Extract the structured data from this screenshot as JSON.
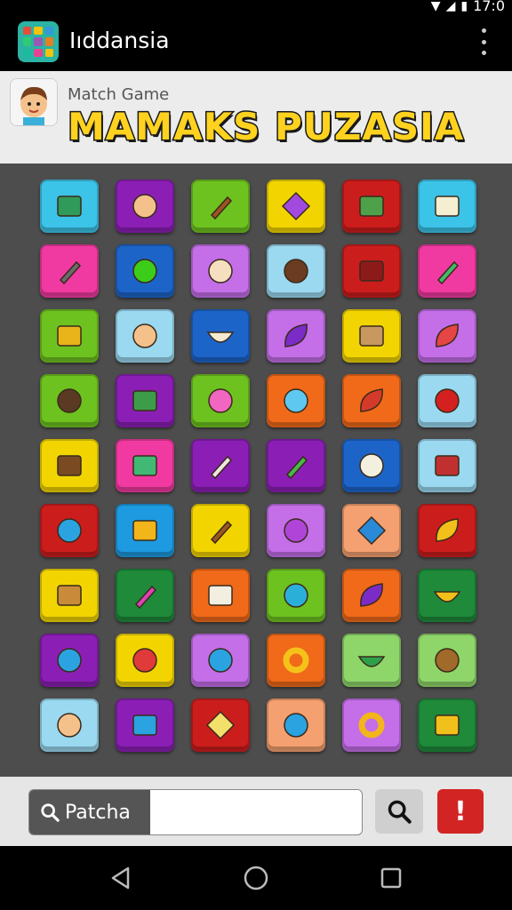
{
  "status_bar": {
    "time": "17:0"
  },
  "app_bar": {
    "title": "Iıddansia"
  },
  "header": {
    "subtitle": "Match Game",
    "title": "MAMAKS PUZASIA"
  },
  "board": {
    "tiles": [
      {
        "name": "book-icon",
        "bg": "#3cc3e8",
        "fg": "#2f9a5a",
        "shape": "square"
      },
      {
        "name": "hat-man-icon",
        "bg": "#8b1fb5",
        "fg": "#f5c18b",
        "shape": "circle"
      },
      {
        "name": "hand-tool-icon",
        "bg": "#6ec21f",
        "fg": "#9b5524",
        "shape": "stick"
      },
      {
        "name": "kite-icon",
        "bg": "#f2d500",
        "fg": "#a24ae0",
        "shape": "diamond"
      },
      {
        "name": "green-box-icon",
        "bg": "#cc1d1d",
        "fg": "#4fa04a",
        "shape": "square"
      },
      {
        "name": "paper-stack-icon",
        "bg": "#3cc3e8",
        "fg": "#f3efd0",
        "shape": "square"
      },
      {
        "name": "standing-man-icon",
        "bg": "#f03aa1",
        "fg": "#6b6b6b",
        "shape": "stick"
      },
      {
        "name": "green-ball-icon",
        "bg": "#1d64c8",
        "fg": "#3ccd1a",
        "shape": "circle"
      },
      {
        "name": "puppy-icon",
        "bg": "#c46ee8",
        "fg": "#f5dfc0",
        "shape": "circle"
      },
      {
        "name": "bald-man-icon",
        "bg": "#9ad9f0",
        "fg": "#6b3c22",
        "shape": "circle"
      },
      {
        "name": "gift-box-icon",
        "bg": "#cc1d1d",
        "fg": "#8d1a1a",
        "shape": "square"
      },
      {
        "name": "microphone-icon",
        "bg": "#f03aa1",
        "fg": "#47b86a",
        "shape": "stick"
      },
      {
        "name": "yellow-crate-icon",
        "bg": "#6ec21f",
        "fg": "#e9b41a",
        "shape": "square"
      },
      {
        "name": "boy-icon",
        "bg": "#9ad9f0",
        "fg": "#f5c18b",
        "shape": "circle"
      },
      {
        "name": "dumpling-icon",
        "bg": "#1d64c8",
        "fg": "#f3ead0",
        "shape": "half"
      },
      {
        "name": "purple-leaf-icon",
        "bg": "#c46ee8",
        "fg": "#7b2cc6",
        "shape": "leaf"
      },
      {
        "name": "brown-box-icon",
        "bg": "#f2d500",
        "fg": "#c7985f",
        "shape": "square"
      },
      {
        "name": "popsicle-icon",
        "bg": "#c46ee8",
        "fg": "#e54545",
        "shape": "leaf"
      },
      {
        "name": "cap-man-icon",
        "bg": "#6ec21f",
        "fg": "#5a3a22",
        "shape": "circle"
      },
      {
        "name": "safe-icon",
        "bg": "#8b1fb5",
        "fg": "#3d9c4a",
        "shape": "square"
      },
      {
        "name": "heart-flower-icon",
        "bg": "#6ec21f",
        "fg": "#f066c0",
        "shape": "circle"
      },
      {
        "name": "magnifier-icon",
        "bg": "#f06a1a",
        "fg": "#5fc8f0",
        "shape": "circle"
      },
      {
        "name": "red-mask-icon",
        "bg": "#f06a1a",
        "fg": "#d43a2a",
        "shape": "leaf"
      },
      {
        "name": "red-flower-icon",
        "bg": "#9ad9f0",
        "fg": "#d42020",
        "shape": "circle"
      },
      {
        "name": "tv-icon",
        "bg": "#f2d500",
        "fg": "#7a4a22",
        "shape": "square"
      },
      {
        "name": "briefcase-icon",
        "bg": "#f03aa1",
        "fg": "#41b874",
        "shape": "square"
      },
      {
        "name": "bottle-icon",
        "bg": "#8b1fb5",
        "fg": "#f0e8e0",
        "shape": "stick"
      },
      {
        "name": "soda-can-icon",
        "bg": "#8b1fb5",
        "fg": "#49b84a",
        "shape": "stick"
      },
      {
        "name": "white-bag-icon",
        "bg": "#1d64c8",
        "fg": "#f3f0e0",
        "shape": "circle"
      },
      {
        "name": "layered-cake-icon",
        "bg": "#9ad9f0",
        "fg": "#c03030",
        "shape": "square"
      },
      {
        "name": "blue-mask-icon",
        "bg": "#cc1d1d",
        "fg": "#2aa3e0",
        "shape": "circle"
      },
      {
        "name": "yellow-case-icon",
        "bg": "#1d9ae0",
        "fg": "#f2b51a",
        "shape": "square"
      },
      {
        "name": "wooden-hand-icon",
        "bg": "#f2d500",
        "fg": "#9b5524",
        "shape": "stick"
      },
      {
        "name": "speech-bubble-icon",
        "bg": "#c46ee8",
        "fg": "#b044d8",
        "shape": "circle"
      },
      {
        "name": "blue-tag-icon",
        "bg": "#f5a070",
        "fg": "#2a8ad8",
        "shape": "diamond"
      },
      {
        "name": "bell-pepper-icon",
        "bg": "#cc1d1d",
        "fg": "#f2c01a",
        "shape": "leaf"
      },
      {
        "name": "radio-icon",
        "bg": "#f2d500",
        "fg": "#c98b3a",
        "shape": "square"
      },
      {
        "name": "pink-jar-icon",
        "bg": "#1f8a3a",
        "fg": "#e040b8",
        "shape": "stick"
      },
      {
        "name": "dice-icon",
        "bg": "#f06a1a",
        "fg": "#f3efe0",
        "shape": "square"
      },
      {
        "name": "teal-drop-icon",
        "bg": "#6ec21f",
        "fg": "#2ab0d8",
        "shape": "circle"
      },
      {
        "name": "purple-feather-icon",
        "bg": "#f06a1a",
        "fg": "#7b2cc6",
        "shape": "leaf"
      },
      {
        "name": "banana-icon",
        "bg": "#1f8a3a",
        "fg": "#f2c01a",
        "shape": "half"
      },
      {
        "name": "blue-drop-icon",
        "bg": "#8b1fb5",
        "fg": "#2aa3e0",
        "shape": "circle"
      },
      {
        "name": "red-drop-icon",
        "bg": "#f2d500",
        "fg": "#e03a3a",
        "shape": "circle"
      },
      {
        "name": "blue-pot-icon",
        "bg": "#c46ee8",
        "fg": "#2aa3e0",
        "shape": "circle"
      },
      {
        "name": "donut-icon",
        "bg": "#f06a1a",
        "fg": "#f5c21a",
        "shape": "ring"
      },
      {
        "name": "green-bowl-icon",
        "bg": "#8fd66a",
        "fg": "#2fa04a",
        "shape": "half"
      },
      {
        "name": "cowboy-icon",
        "bg": "#8fd66a",
        "fg": "#a06a2a",
        "shape": "circle"
      },
      {
        "name": "smiling-boy-icon",
        "bg": "#9ad9f0",
        "fg": "#f5c18b",
        "shape": "circle"
      },
      {
        "name": "picture-frame-icon",
        "bg": "#8b1fb5",
        "fg": "#2aa3e0",
        "shape": "square"
      },
      {
        "name": "butter-icon",
        "bg": "#cc1d1d",
        "fg": "#f2e06a",
        "shape": "diamond"
      },
      {
        "name": "blue-candy-icon",
        "bg": "#f5a070",
        "fg": "#2aa3e0",
        "shape": "circle"
      },
      {
        "name": "orange-lollipop-icon",
        "bg": "#c46ee8",
        "fg": "#f2b51a",
        "shape": "ring"
      },
      {
        "name": "yellow-notes-icon",
        "bg": "#1f8a3a",
        "fg": "#f2c01a",
        "shape": "square"
      }
    ]
  },
  "search": {
    "label": "Patcha",
    "value": ""
  },
  "colors": {
    "alert": "#d32424",
    "title_fill": "#ffd21f"
  }
}
